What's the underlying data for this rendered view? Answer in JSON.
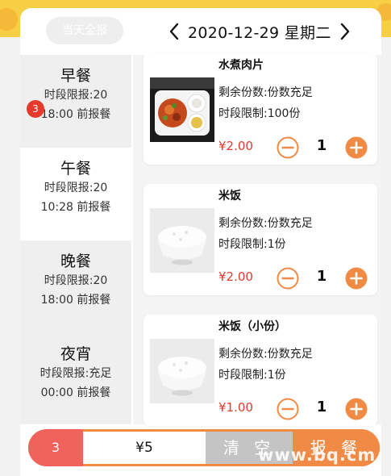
{
  "header": {
    "all_report_label": "当天全报",
    "date_text": "2020-12-29 星期二",
    "prev_icon": "chevron-left-icon",
    "next_icon": "chevron-right-icon"
  },
  "sidebar": {
    "items": [
      {
        "name": "早餐",
        "line1": "时段限报:20",
        "line2": "18:00 前报餐",
        "active": false
      },
      {
        "name": "午餐",
        "line1": "时段限报:20",
        "line2": "10:28 前报餐",
        "active": true,
        "badge": "3"
      },
      {
        "name": "晚餐",
        "line1": "时段限报:20",
        "line2": "18:00 前报餐",
        "active": false
      },
      {
        "name": "夜宵",
        "line1": "时段限报:充足",
        "line2": "00:00 前报餐",
        "active": false
      }
    ]
  },
  "dishes": [
    {
      "name": "水煮肉片",
      "remaining": "剩余份数:份数充足",
      "limit": "时段限制:100份",
      "price": "¥2.00",
      "qty": "1",
      "image": "spicy-boiled-pork-photo"
    },
    {
      "name": "米饭",
      "remaining": "剩余份数:份数充足",
      "limit": "时段限制:1份",
      "price": "¥2.00",
      "qty": "1",
      "image": "rice-bowl-photo"
    },
    {
      "name": "米饭（小份）",
      "remaining": "剩余份数:份数充足",
      "limit": "时段限制:1份",
      "price": "¥1.00",
      "qty": "1",
      "image": "rice-bowl-photo"
    }
  ],
  "footer": {
    "count": "3",
    "total": "¥5",
    "clear_label": "清 空",
    "submit_label": "报 餐"
  },
  "watermark": "www.bq.cm",
  "colors": {
    "accent_orange": "#f08a45",
    "price_red": "#e23a2c",
    "badge_red": "#e73a2d",
    "count_bg": "#f0625c",
    "clear_bg": "#c4c4c4",
    "top_band": "#f7cf45"
  }
}
